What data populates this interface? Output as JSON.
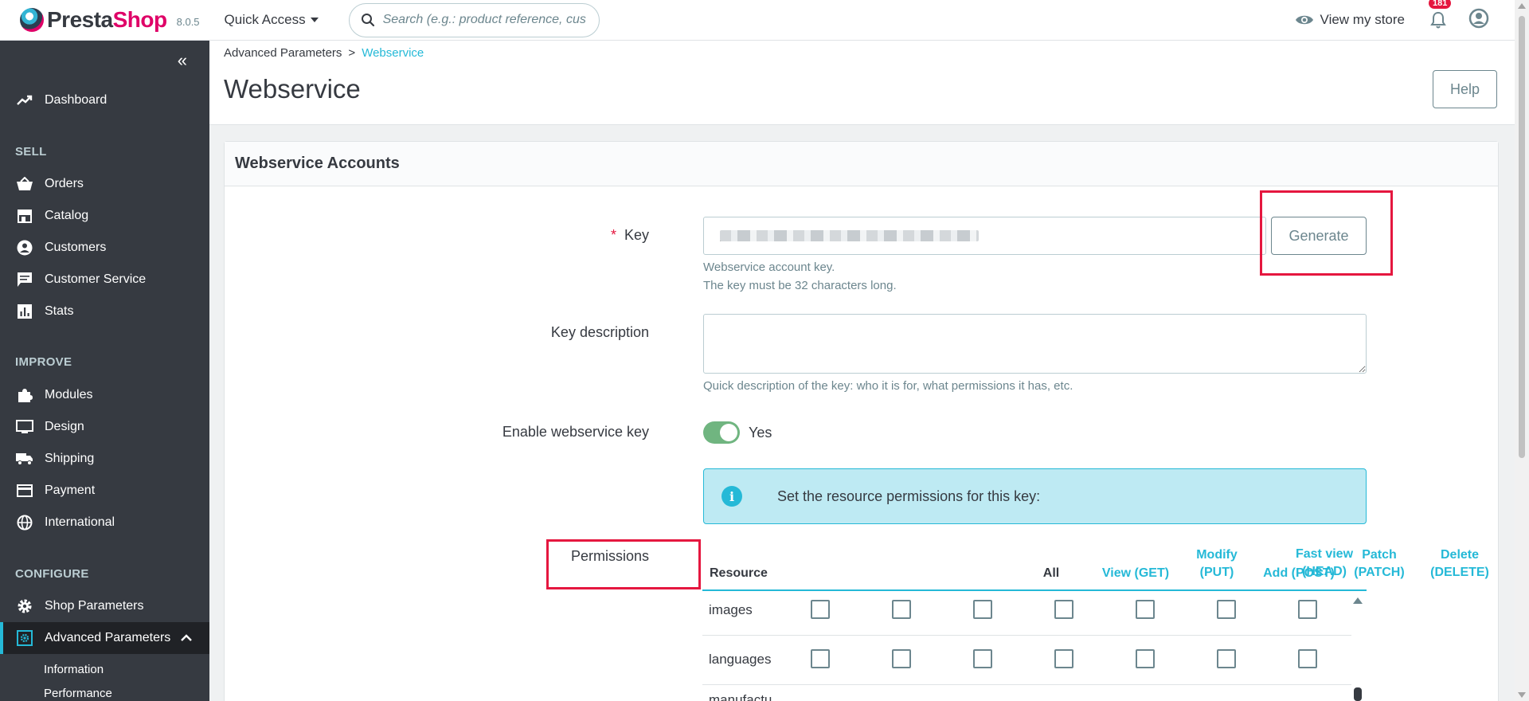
{
  "topbar": {
    "logo_main": "Presta",
    "logo_accent": "Shop",
    "version": "8.0.5",
    "quick_access": "Quick Access",
    "search_placeholder": "Search (e.g.: product reference, custon",
    "view_store": "View my store",
    "notifications_count": "181"
  },
  "sidebar": {
    "dashboard": "Dashboard",
    "sections": {
      "sell": "SELL",
      "improve": "IMPROVE",
      "configure": "CONFIGURE"
    },
    "sell_items": [
      "Orders",
      "Catalog",
      "Customers",
      "Customer Service",
      "Stats"
    ],
    "improve_items": [
      "Modules",
      "Design",
      "Shipping",
      "Payment",
      "International"
    ],
    "configure_items": [
      "Shop Parameters",
      "Advanced Parameters"
    ],
    "sub_items": [
      "Information",
      "Performance"
    ]
  },
  "header": {
    "breadcrumb_parent": "Advanced Parameters",
    "breadcrumb_sep": ">",
    "breadcrumb_current": "Webservice",
    "title": "Webservice",
    "help": "Help"
  },
  "form": {
    "card_title": "Webservice Accounts",
    "key_label": "Key",
    "required_mark": "*",
    "key_suffix": "_",
    "generate": "Generate",
    "key_help_1": "Webservice account key.",
    "key_help_2": "The key must be 32 characters long.",
    "desc_label": "Key description",
    "desc_help": "Quick description of the key: who it is for, what permissions it has, etc.",
    "enable_label": "Enable webservice key",
    "enable_value": "Yes",
    "alert": "Set the resource permissions for this key:",
    "permissions_label": "Permissions"
  },
  "permissions": {
    "headers": {
      "resource": "Resource",
      "all": "All",
      "get": "View (GET)",
      "put_1": "Modify",
      "put_2": "(PUT)",
      "post": "Add (POST)",
      "patch_1": "Patch",
      "patch_2": "(PATCH)",
      "delete_1": "Delete",
      "delete_2": "(DELETE)",
      "head_1": "Fast view",
      "head_2": "(HEAD)"
    },
    "rows": [
      "images",
      "languages",
      "manufactu"
    ]
  }
}
